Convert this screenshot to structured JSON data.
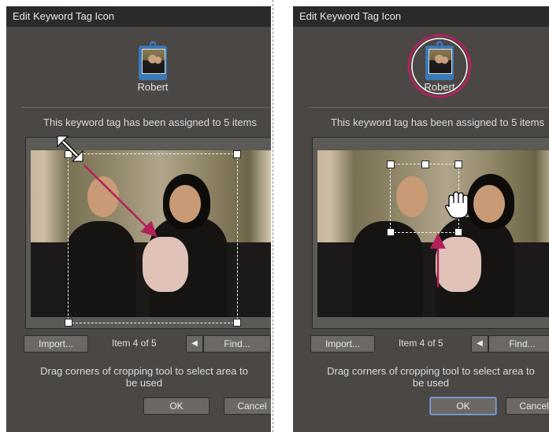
{
  "dialog_title": "Edit Keyword Tag Icon",
  "tag_name": "Robert",
  "assigned_message": "This keyword tag has been assigned to 5 items",
  "import_label": "Import...",
  "item_counter": "Item 4 of 5",
  "find_label": "Find...",
  "instruction_line1": "Drag corners of cropping tool to select area to",
  "instruction_line2": "be used",
  "ok_label": "OK",
  "cancel_label": "Cancel",
  "icons": {
    "tag": "keyword-tag-icon",
    "resize_cursor": "diagonal-resize-cursor-icon",
    "hand_cursor": "hand-cursor-icon",
    "prev": "triangle-left-icon"
  },
  "colors": {
    "annotation": "#b3205a",
    "dialog_bg": "#4a4744",
    "titlebar": "#2c2a29",
    "tag_blue": "#3a78b8"
  }
}
